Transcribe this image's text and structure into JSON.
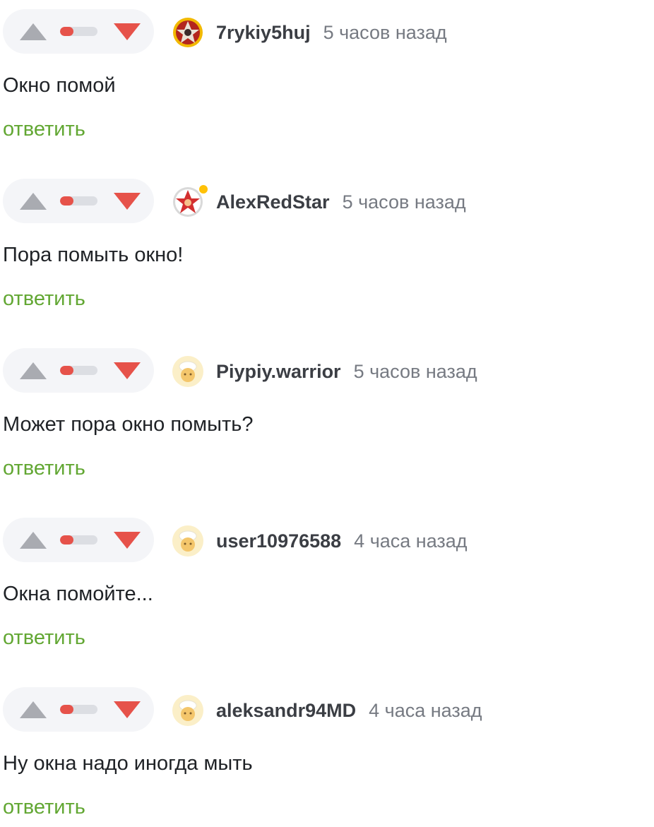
{
  "colors": {
    "pill_bg": "#f4f5f8",
    "upvote_arrow": "#a9abb1",
    "downvote_arrow": "#e6524a",
    "rating_negative": "#e6524a",
    "rating_track": "#dcdee3",
    "reply_link": "#62a733",
    "online_dot": "#ffc107"
  },
  "comments": [
    {
      "author": "7rykiy5huj",
      "time": "5 часов назад",
      "text": "Окно помой",
      "reply_label": "ответить",
      "avatar_icon": "warrior-emblem-icon",
      "online": false,
      "rating_fraction": 0.35
    },
    {
      "author": "AlexRedStar",
      "time": "5 часов назад",
      "text": "Пора помыть окно!",
      "reply_label": "ответить",
      "avatar_icon": "red-star-badge-icon",
      "online": true,
      "rating_fraction": 0.35
    },
    {
      "author": "Piypiy.warrior",
      "time": "5 часов назад",
      "text": "Может пора окно помыть?",
      "reply_label": "ответить",
      "avatar_icon": "chef-default-avatar-icon",
      "online": false,
      "rating_fraction": 0.35
    },
    {
      "author": "user10976588",
      "time": "4 часа назад",
      "text": "Окна помойте...",
      "reply_label": "ответить",
      "avatar_icon": "chef-default-avatar-icon",
      "online": false,
      "rating_fraction": 0.35
    },
    {
      "author": "aleksandr94MD",
      "time": "4 часа назад",
      "text": "Ну окна надо иногда мыть",
      "reply_label": "ответить",
      "avatar_icon": "chef-default-avatar-icon",
      "online": false,
      "rating_fraction": 0.35
    }
  ]
}
